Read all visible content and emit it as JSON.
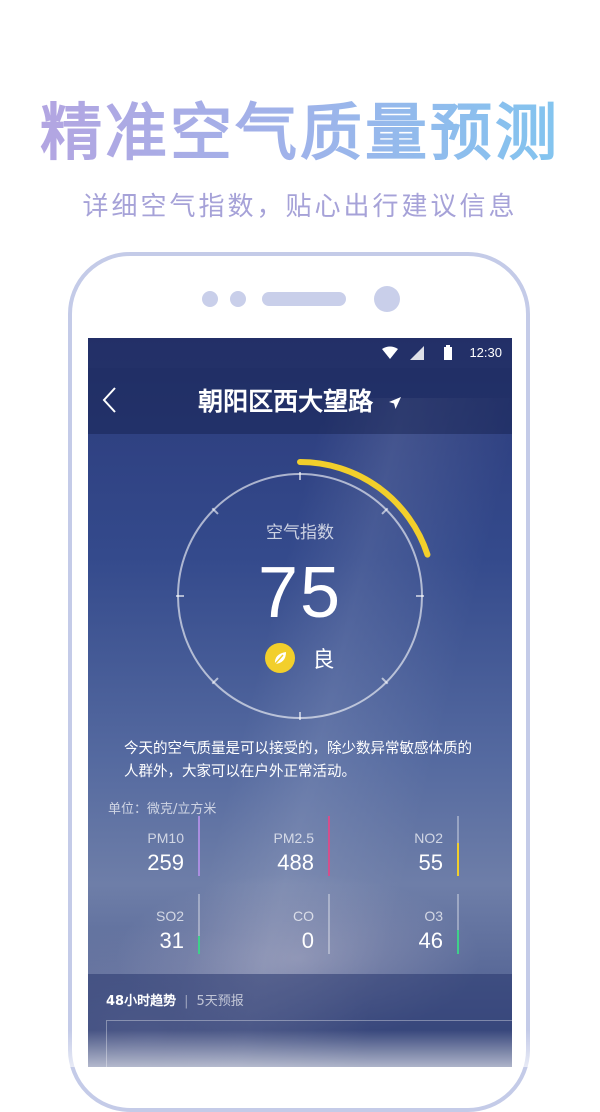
{
  "promo": {
    "title": "精准空气质量预测",
    "subtitle": "详细空气指数，贴心出行建议信息"
  },
  "status_bar": {
    "time": "12:30"
  },
  "header": {
    "location": "朝阳区西大望路"
  },
  "aqi": {
    "label": "空气指数",
    "value": "75",
    "level": "良",
    "gauge_fraction": 0.2,
    "gauge_color": "#f2cf2b"
  },
  "advice": "今天的空气质量是可以接受的，除少数异常敏感体质的人群外，大家可以在户外正常活动。",
  "unit_label": "单位：微克/立方米",
  "pollutants": [
    {
      "name": "PM10",
      "value": "259",
      "color": "#a98ee0",
      "level_fraction": 1.0
    },
    {
      "name": "PM2.5",
      "value": "488",
      "color": "#d44f8c",
      "level_fraction": 1.0
    },
    {
      "name": "NO2",
      "value": "55",
      "color": "#f2cf2b",
      "level_fraction": 0.55
    },
    {
      "name": "SO2",
      "value": "31",
      "color": "#3fd08a",
      "level_fraction": 0.3
    },
    {
      "name": "CO",
      "value": "0",
      "color": "#3fd08a",
      "level_fraction": 0.0
    },
    {
      "name": "O3",
      "value": "46",
      "color": "#3fd08a",
      "level_fraction": 0.4
    }
  ],
  "tabs": {
    "active": "48小时趋势",
    "separator": "|",
    "inactive": "5天预报"
  }
}
